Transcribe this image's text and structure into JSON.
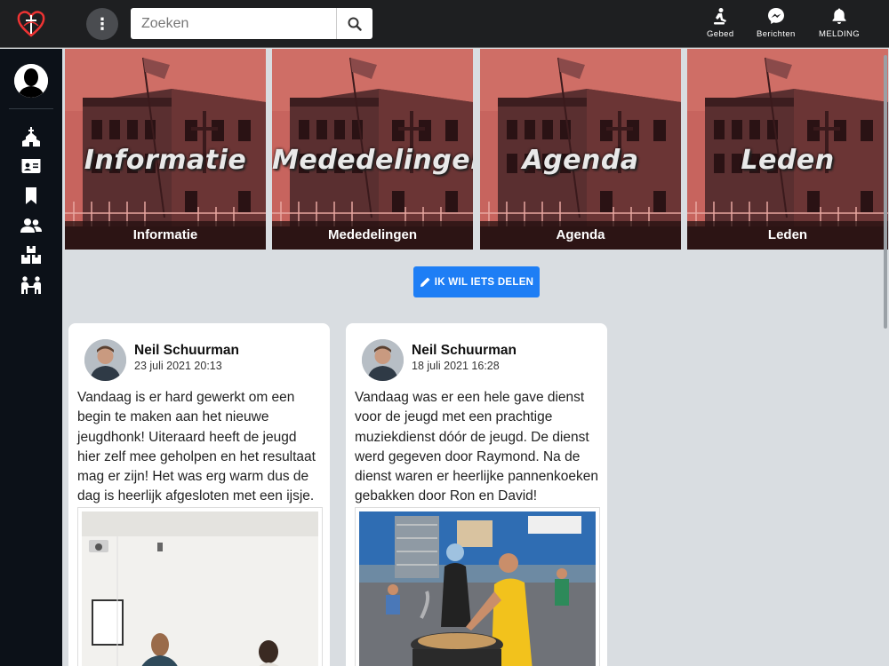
{
  "header": {
    "search_placeholder": "Zoeken",
    "nav": [
      {
        "label": "Gebed",
        "icon": "praying-icon"
      },
      {
        "label": "Berichten",
        "icon": "messenger-icon"
      },
      {
        "label": "MELDING",
        "icon": "bell-icon"
      }
    ]
  },
  "sidebar": {
    "items": [
      {
        "icon": "church-icon"
      },
      {
        "icon": "id-card-icon"
      },
      {
        "icon": "bookmark-icon"
      },
      {
        "icon": "users-icon"
      },
      {
        "icon": "boxes-icon"
      },
      {
        "icon": "people-meeting-icon"
      }
    ]
  },
  "tiles": [
    {
      "title": "Informatie",
      "caption": "Informatie"
    },
    {
      "title": "Mededelingen",
      "caption": "Mededelingen"
    },
    {
      "title": "Agenda",
      "caption": "Agenda"
    },
    {
      "title": "Leden",
      "caption": "Leden"
    }
  ],
  "share_button": {
    "label": "IK WIL IETS DELEN"
  },
  "posts": [
    {
      "author": "Neil Schuurman",
      "date": "23 juli 2021 20:13",
      "text": "Vandaag is er hard gewerkt om een begin te maken aan het nieuwe jeugdhonk! Uiteraard heeft de jeugd hier zelf mee geholpen en het resultaat mag er zijn! Het was erg warm dus de dag is heerlijk afgesloten met een ijsje."
    },
    {
      "author": "Neil Schuurman",
      "date": "18 juli 2021 16:28",
      "text": "Vandaag was er een hele gave dienst voor de jeugd met een prachtige muziekdienst dóór de jeugd. De dienst werd gegeven door Raymond. Na de dienst waren er heerlijke pannenkoeken gebakken door Ron en David!"
    }
  ],
  "colors": {
    "accent": "#1e7ef5",
    "topbar": "#1e1f21",
    "sidebar": "#0c1118",
    "background": "#d9dde1"
  }
}
